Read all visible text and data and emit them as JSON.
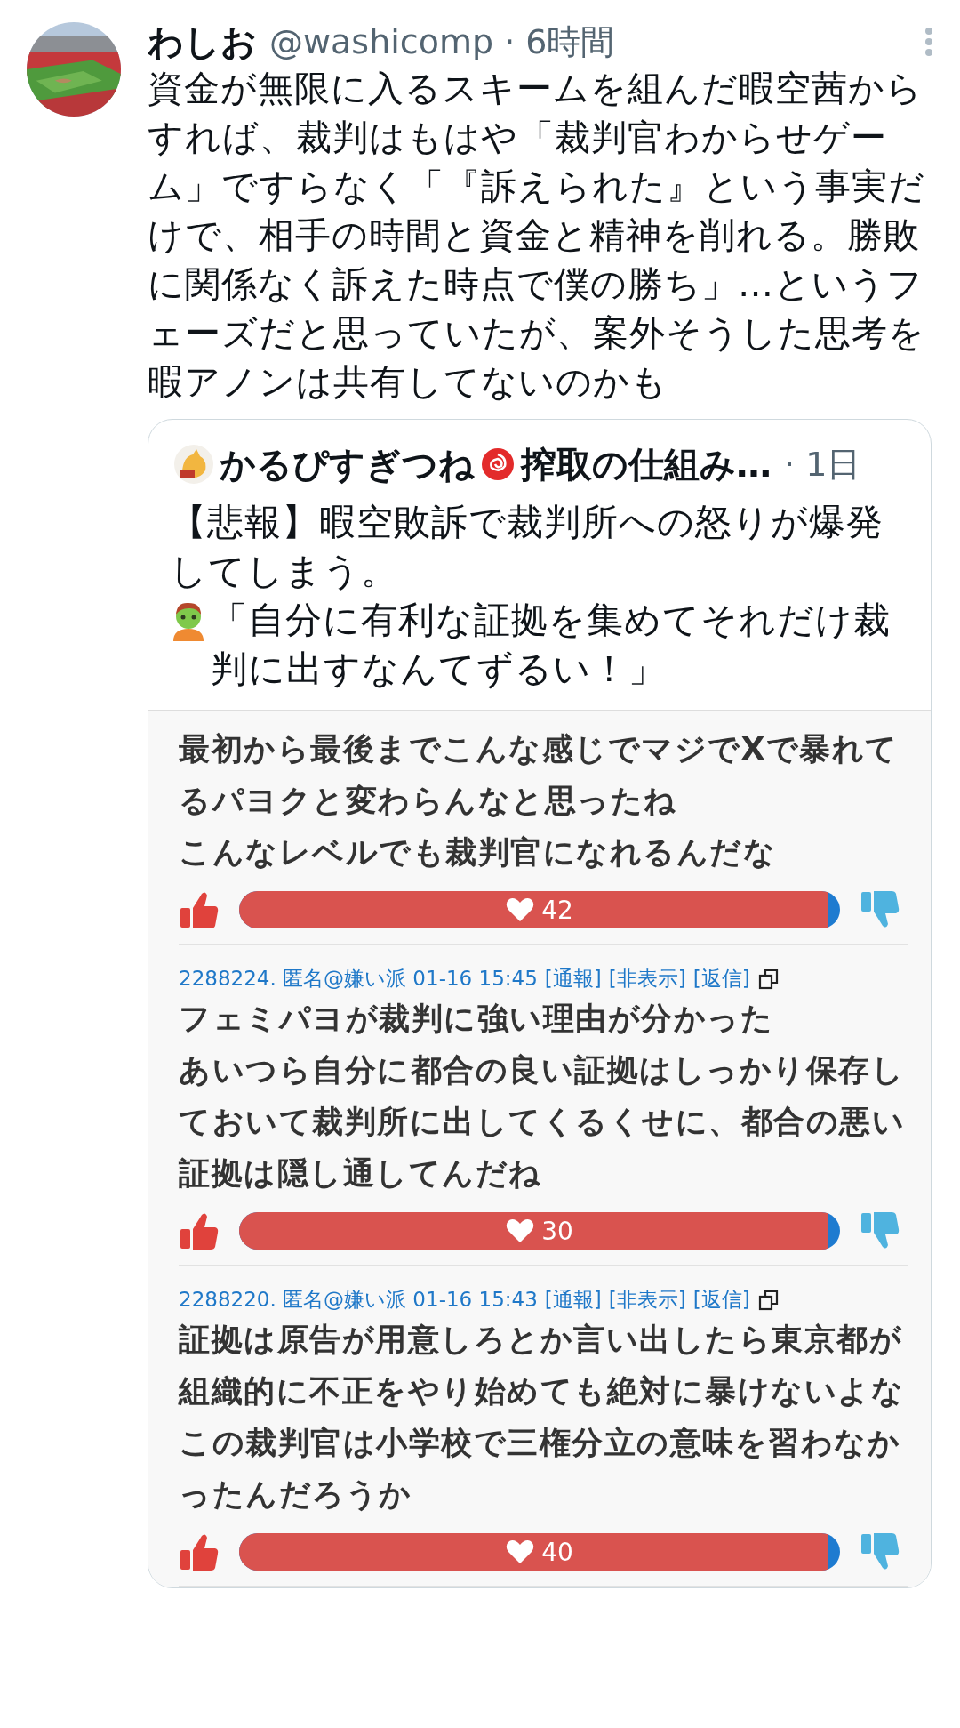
{
  "tweet": {
    "author": {
      "name": "わしお",
      "meta": "@washicomp · 6時間"
    },
    "text": "資金が無限に入るスキームを組んだ暇空茜からすれば、裁判はもはや「裁判官わからせゲーム」ですらなく「『訴えられた』という事実だけで、相手の時間と資金と精神を削れる。勝敗に関係なく訴えた時点で僕の勝ち」…というフェーズだと思っていたが、案外そうした思考を暇アノンは共有してないのかも",
    "quote": {
      "author_name": "かるぴすぎつね",
      "author_suffix": "搾取の仕組み…",
      "time": "· 1日",
      "text": "【悲報】暇空敗訴で裁判所への怒りが爆発してしまう。",
      "text_2": "「自分に有利な証拠を集めてそれだけ裁判に出すなんてずるい！」",
      "image": {
        "comments": [
          {
            "paragraphs": [
              "最初から最後までこんな感じでマジでXで暴れてるパヨクと変わらんなと思ったね",
              "こんなレベルでも裁判官になれるんだな"
            ],
            "likes": "42",
            "level": 0.98
          },
          {
            "meta": "2288224. 匿名@嫌い派 01-16 15:45",
            "links": [
              "[通報]",
              "[非表示]",
              "[返信]"
            ],
            "paragraphs": [
              "フェミパヨが裁判に強い理由が分かった",
              "あいつら自分に都合の良い証拠はしっかり保存しておいて裁判所に出してくるくせに、都合の悪い証拠は隠し通してんだね"
            ],
            "likes": "30",
            "level": 0.98
          },
          {
            "meta": "2288220. 匿名@嫌い派 01-16 15:43",
            "links": [
              "[通報]",
              "[非表示]",
              "[返信]"
            ],
            "paragraphs": [
              "証拠は原告が用意しろとか言い出したら東京都が組織的に不正をやり始めても絶対に暴けないよな",
              "この裁判官は小学校で三権分立の意味を習わなかったんだろうか"
            ],
            "likes": "40",
            "level": 0.98
          }
        ]
      }
    }
  }
}
